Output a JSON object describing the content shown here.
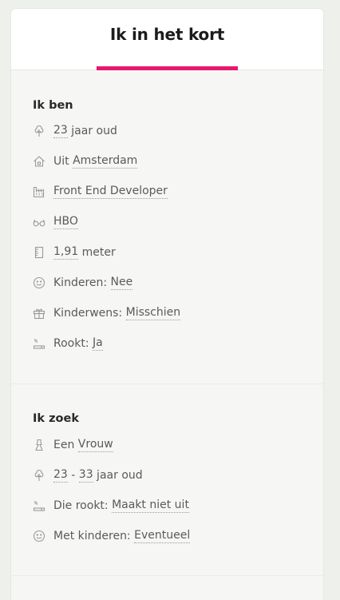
{
  "header": {
    "title": "Ik in het kort"
  },
  "ikben": {
    "heading": "Ik ben",
    "age_value": "23",
    "age_suffix": " jaar oud",
    "city_prefix": "Uit ",
    "city_value": "Amsterdam",
    "job_value": "Front End Developer",
    "edu_value": "HBO",
    "height_value": "1,91",
    "height_suffix": " meter",
    "kids_prefix": "Kinderen: ",
    "kids_value": "Nee",
    "kidwish_prefix": "Kinderwens: ",
    "kidwish_value": "Misschien",
    "smoke_prefix": "Rookt: ",
    "smoke_value": "Ja"
  },
  "ikzoek": {
    "heading": "Ik zoek",
    "gender_prefix": "Een ",
    "gender_value": "Vrouw",
    "age_min": "23",
    "age_sep": " - ",
    "age_max": "33",
    "age_suffix": " jaar oud",
    "smoke_prefix": "Die rookt: ",
    "smoke_value": "Maakt niet uit",
    "kids_prefix": "Met kinderen: ",
    "kids_value": "Eventueel"
  },
  "icons": {
    "age": "tree-icon",
    "city": "house-icon",
    "job": "factory-icon",
    "edu": "glasses-icon",
    "height": "ruler-icon",
    "kids": "smiley-icon",
    "kidwish": "gift-icon",
    "smoke": "cigarette-icon",
    "gender": "dress-icon"
  },
  "colors": {
    "accent": "#e8176f",
    "icon": "#9a9a9a"
  }
}
